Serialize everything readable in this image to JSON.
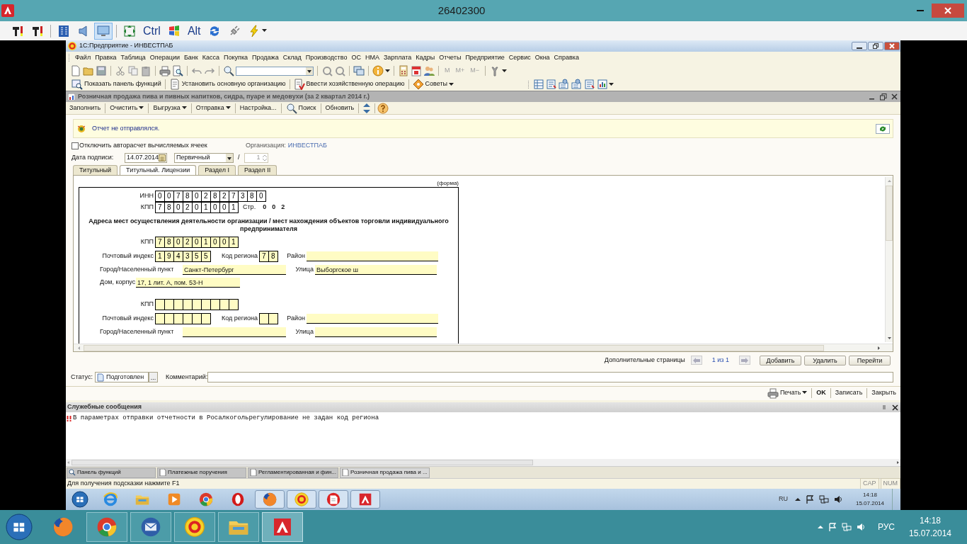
{
  "window": {
    "title": "26402300"
  },
  "remote_toolbar": [
    {
      "kind": "tool",
      "selected": false
    },
    {
      "kind": "tool",
      "selected": false
    },
    {
      "kind": "panel",
      "selected": false
    },
    {
      "kind": "speaker",
      "selected": false
    },
    {
      "kind": "monitor",
      "selected": true
    },
    {
      "kind": "move",
      "selected": false
    },
    {
      "kind": "key",
      "label": "Ctrl",
      "selected": false
    },
    {
      "kind": "flag",
      "selected": false
    },
    {
      "kind": "key",
      "label": "Alt",
      "selected": false
    },
    {
      "kind": "refresh",
      "selected": false
    },
    {
      "kind": "plug",
      "selected": false
    },
    {
      "kind": "lightning",
      "selected": false
    }
  ],
  "app": {
    "title": "1С:Предприятие - ИНВЕСТПАБ"
  },
  "menu": [
    "Файл",
    "Правка",
    "Таблица",
    "Операции",
    "Банк",
    "Касса",
    "Покупка",
    "Продажа",
    "Склад",
    "Производство",
    "ОС",
    "НМА",
    "Зарплата",
    "Кадры",
    "Отчеты",
    "Предприятие",
    "Сервис",
    "Окна",
    "Справка"
  ],
  "memory_buttons": [
    {
      "label": "M",
      "disabled": true
    },
    {
      "label": "M+",
      "disabled": true
    },
    {
      "label": "M−",
      "disabled": true
    }
  ],
  "function_toolbar": [
    {
      "kind": "panel",
      "label": "Показать панель функций"
    },
    {
      "kind": "organization",
      "label": "Установить основную организацию"
    },
    {
      "kind": "operation",
      "label": "Ввести хозяйственную операцию"
    },
    {
      "kind": "tips",
      "label": "Советы"
    }
  ],
  "document": {
    "title": "Розничная продажа пива и пивных напитков, сидра, пуаре и медовухи (за 2 квартал 2014 г.)",
    "toolbar": [
      {
        "kind": "plain",
        "label": "Заполнить"
      },
      {
        "kind": "menu",
        "label": "Очистить"
      },
      {
        "kind": "menu",
        "label": "Выгрузка"
      },
      {
        "kind": "menu",
        "label": "Отправка"
      },
      {
        "kind": "plain",
        "label": "Настройка..."
      },
      {
        "kind": "search",
        "label": "Поиск"
      },
      {
        "kind": "plain",
        "label": "Обновить"
      }
    ],
    "notice": "Отчет не отправлялся.",
    "autocalc": {
      "label": "Отключить авторасчет вычисляемых ячеек",
      "checked": false
    },
    "organization": {
      "label": "Организация:",
      "value": "ИНВЕСТПАБ"
    },
    "signature_date": {
      "label": "Дата подписи:",
      "value": "14.07.2014"
    },
    "report_type": {
      "value": "Первичный"
    },
    "separator": "/",
    "correction_number": {
      "value": "1",
      "disabled": true
    },
    "tabs": [
      {
        "label": "Титульный",
        "selected": false
      },
      {
        "label": "Титульный. Лицензии",
        "selected": true
      },
      {
        "label": "Раздел I",
        "selected": false
      },
      {
        "label": "Раздел II",
        "selected": false
      }
    ],
    "form": {
      "caption": "(форма)",
      "inn": {
        "label": "ИНН",
        "value": "007802827380"
      },
      "kpp": {
        "label": "КПП",
        "value": "780201001"
      },
      "page": {
        "label": "Стр.",
        "value": "002"
      },
      "heading": "Адреса мест осуществления деятельности  организации   /   мест нахождения объектов торговли индивидуального предпринимателя",
      "address_blocks": [
        {
          "kpp": {
            "label": "КПП",
            "value": "780201001"
          },
          "postal": {
            "label": "Почтовый индекс",
            "value": "194355"
          },
          "region": {
            "label": "Код региона",
            "value": "78"
          },
          "district": {
            "label": "Район"
          },
          "city": {
            "label": "Город/Населенный пункт",
            "value": "Санкт-Петербург"
          },
          "street": {
            "label": "Улица",
            "value": "Выборгское ш"
          },
          "house": {
            "label": "Дом, корпус",
            "value": "17, 1 лит. А, пом. 53-Н"
          }
        },
        {
          "kpp": {
            "label": "КПП"
          },
          "postal": {
            "label": "Почтовый индекс"
          },
          "region": {
            "label": "Код региона"
          },
          "district": {
            "label": "Район"
          },
          "city": {
            "label": "Город/Населенный пункт"
          },
          "street": {
            "label": "Улица"
          }
        }
      ]
    },
    "additional_pages": {
      "label": "Дополнительные страницы",
      "counter": "1 из 1",
      "buttons": [
        "Добавить",
        "Удалить",
        "Перейти"
      ]
    },
    "status": {
      "label": "Статус:",
      "value": "Подготовлен",
      "button": "...",
      "comment_label": "Комментарий:"
    },
    "actions": [
      {
        "kind": "menu",
        "label": "Печать"
      },
      {
        "kind": "default",
        "label": "OK"
      },
      {
        "kind": "plain",
        "label": "Записать"
      },
      {
        "kind": "plain",
        "label": "Закрыть"
      }
    ]
  },
  "messages": {
    "title": "Служебные сообщения",
    "items": [
      "В параметрах отправки отчетности в Росалкогольрегулирование не задан код региона"
    ]
  },
  "window_tabs": [
    {
      "label": "Панель функций",
      "selected": false
    },
    {
      "label": "Платежные поручения",
      "selected": false
    },
    {
      "label": "Регламентированная и фин...",
      "selected": false
    },
    {
      "label": "Розничная продажа пива и ...",
      "selected": true
    }
  ],
  "status_bar": {
    "hint": "Для получения подсказки нажмите F1",
    "indicators": [
      "CAP",
      "NUM"
    ]
  },
  "inner_taskbar": {
    "apps": [
      {
        "kind": "ie",
        "open": false
      },
      {
        "kind": "explorer",
        "open": false
      },
      {
        "kind": "media",
        "open": false
      },
      {
        "kind": "chrome",
        "open": false
      },
      {
        "kind": "opera",
        "open": false
      },
      {
        "kind": "firefox",
        "open": true
      },
      {
        "kind": "onec",
        "open": true
      },
      {
        "kind": "document",
        "open": true
      },
      {
        "kind": "remote",
        "open": true
      }
    ],
    "language": "RU",
    "time": "14:18",
    "date": "15.07.2014"
  },
  "taskbar": {
    "apps": [
      {
        "kind": "firefox",
        "open": false
      },
      {
        "kind": "chrome",
        "open": true
      },
      {
        "kind": "mail",
        "open": true
      },
      {
        "kind": "onec",
        "open": true
      },
      {
        "kind": "explorer",
        "open": true
      },
      {
        "kind": "remote",
        "open": true
      }
    ],
    "language": "РУС",
    "time": "14:18",
    "date": "15.07.2014"
  }
}
